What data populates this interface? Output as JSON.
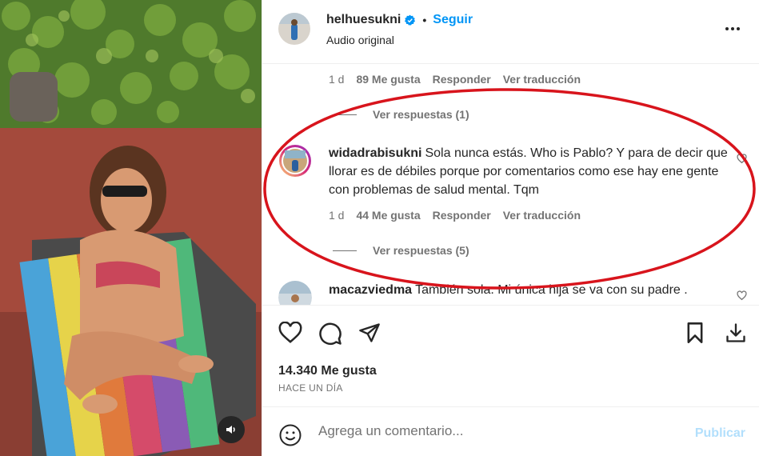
{
  "header": {
    "username": "helhuesukni",
    "follow_label": "Seguir",
    "separator": "•",
    "subtitle": "Audio original",
    "more_icon": "more-horizontal-icon"
  },
  "comments": {
    "prev_meta": {
      "time": "1 d",
      "likes": "89 Me gusta",
      "reply": "Responder",
      "translate": "Ver traducción"
    },
    "prev_replies": "Ver respuestas (1)",
    "highlighted": {
      "username": "widadrabisukni",
      "text": "Sola nunca estás. Who is Pablo? Y para de decir que llorar es de débiles porque por comentarios como ese hay ene gente con problemas de salud mental. Tqm",
      "time": "1 d",
      "likes": "44 Me gusta",
      "reply": "Responder",
      "translate": "Ver traducción",
      "replies": "Ver respuestas (5)"
    },
    "next": {
      "username": "macazviedma",
      "text": "También sola. Mi única hija se va con su padre ."
    }
  },
  "actions": {
    "icons": [
      "heart-icon",
      "comment-icon",
      "share-icon",
      "bookmark-icon",
      "download-icon"
    ],
    "likes": "14.340 Me gusta",
    "time_ago": "HACE UN DÍA"
  },
  "composer": {
    "placeholder": "Agrega un comentario...",
    "publish_label": "Publicar",
    "emoji_icon": "emoji-icon"
  },
  "colors": {
    "accent": "#0095f6",
    "annotation": "#d8141c",
    "muted": "#737373"
  }
}
